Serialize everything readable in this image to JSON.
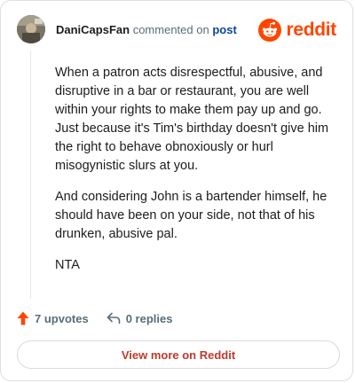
{
  "comment": {
    "author": "DaniCapsFan",
    "action_text": "commented on",
    "post_link_label": "post",
    "paragraphs": [
      "When a patron acts disrespectful, abusive, and disruptive in a bar or restaurant, you are well within your rights to make them pay up and go. Just because it's Tim's birthday doesn't give him the right to behave obnoxiously or hurl misogynistic slurs at you.",
      "And considering John is a bartender himself, he should have been on your side, not that of his drunken, abusive pal.",
      "NTA"
    ]
  },
  "brand": {
    "name": "reddit",
    "color": "#ff4500"
  },
  "stats": {
    "upvotes_label": "7 upvotes",
    "replies_label": "0 replies"
  },
  "footer": {
    "view_more_label": "View more on Reddit"
  },
  "icons": {
    "upvote": "upvote-arrow-icon",
    "reply": "reply-arrow-icon",
    "brand": "reddit-snoo-icon"
  },
  "colors": {
    "accent": "#ff4500",
    "link": "#0a449b",
    "muted": "#576f76",
    "button_text": "#c0392b"
  }
}
